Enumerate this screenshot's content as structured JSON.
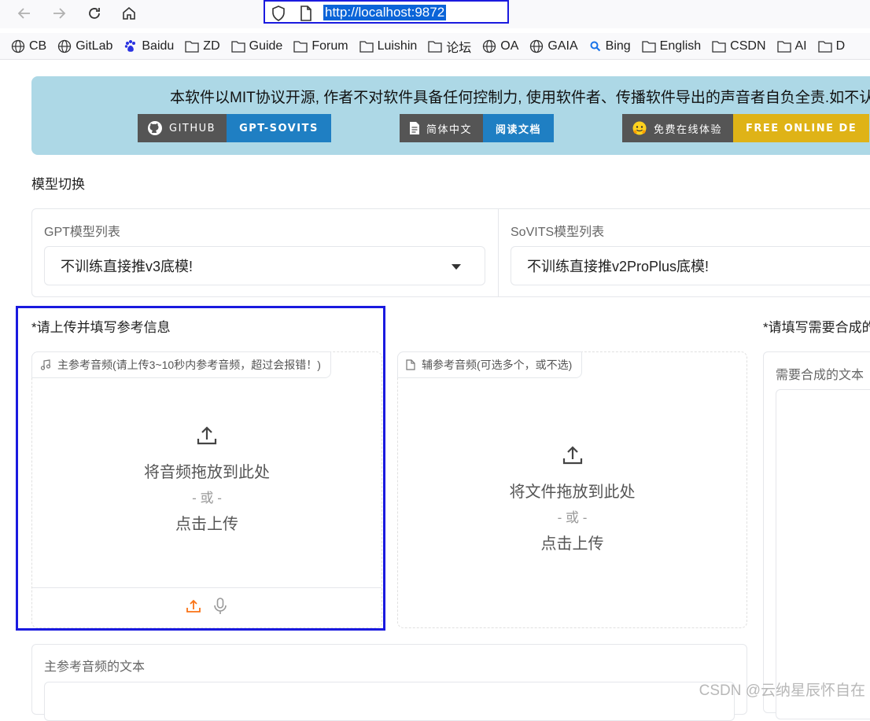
{
  "browser": {
    "url": "http://localhost:9872",
    "bookmarks": [
      "CB",
      "GitLab",
      "Baidu",
      "ZD",
      "Guide",
      "Forum",
      "Luishin",
      "论坛",
      "OA",
      "GAIA",
      "Bing",
      "English",
      "CSDN",
      "AI",
      "D"
    ]
  },
  "banner": {
    "text": "本软件以MIT协议开源, 作者不对软件具备任何控制力, 使用软件者、传播软件导出的声音者自负全责.如不认可",
    "badges": [
      {
        "left": "GITHUB",
        "right": "GPT-SOVITS",
        "color": "#1f7fc3"
      },
      {
        "left": "简体中文",
        "right": "阅读文档",
        "color": "#1f7fc3"
      },
      {
        "left": "免费在线体验",
        "right": "FREE ONLINE DE",
        "color": "#dfb317"
      }
    ]
  },
  "model_switch": {
    "title": "模型切换",
    "gpt": {
      "label": "GPT模型列表",
      "value": "不训练直接推v3底模!"
    },
    "sovits": {
      "label": "SoVITS模型列表",
      "value": "不训练直接推v2ProPlus底模!"
    }
  },
  "reference": {
    "title": "*请上传并填写参考信息",
    "main_audio": {
      "label": "主参考音频(请上传3~10秒内参考音频，超过会报错！)",
      "drop": "将音频拖放到此处",
      "or": "- 或 -",
      "click": "点击上传"
    },
    "aux_audio": {
      "label": "辅参考音频(可选多个，或不选)",
      "drop": "将文件拖放到此处",
      "or": "- 或 -",
      "click": "点击上传"
    },
    "main_text_label": "主参考音频的文本"
  },
  "synthesis": {
    "title": "*请填写需要合成的",
    "text_label": "需要合成的文本"
  },
  "watermark": "CSDN @云纳星辰怀自在"
}
